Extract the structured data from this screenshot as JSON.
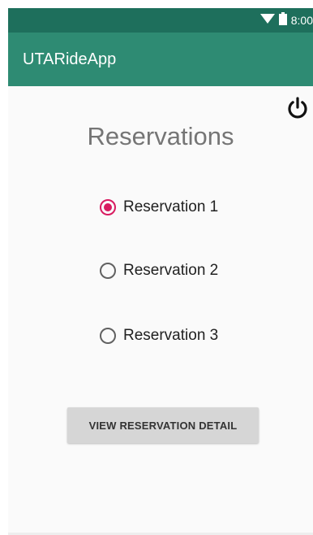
{
  "status_bar": {
    "time": "8:00",
    "icons": [
      "wifi-icon",
      "battery-icon"
    ]
  },
  "app_bar": {
    "title": "UTARideApp"
  },
  "header_actions": {
    "power_icon": "power-icon"
  },
  "main": {
    "title": "Reservations",
    "reservations": [
      {
        "label": "Reservation 1",
        "checked": true
      },
      {
        "label": "Reservation 2",
        "checked": false
      },
      {
        "label": "Reservation 3",
        "checked": false
      }
    ],
    "view_button_label": "VIEW RESERVATION DETAIL"
  },
  "colors": {
    "status_bar": "#1e6f5c",
    "app_bar": "#2e8b73",
    "accent": "#d81b60",
    "title_text": "#757575",
    "button_bg": "#d6d6d6"
  }
}
